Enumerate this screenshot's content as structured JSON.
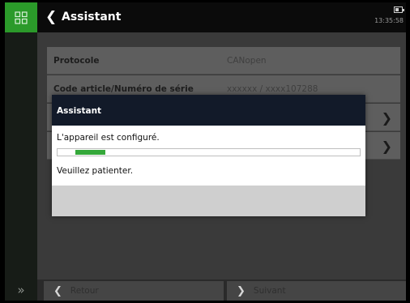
{
  "header": {
    "title": "Assistant",
    "time": "13:35:58"
  },
  "parameters": [
    {
      "label": "Protocole",
      "value": "CANopen"
    },
    {
      "label": "Code article/Numéro de série",
      "value": "xxxxxx / xxxx107288"
    }
  ],
  "footer": {
    "back_label": "Retour",
    "next_label": "Suivant"
  },
  "dialog": {
    "title": "Assistant",
    "message": "L'appareil est configuré.",
    "wait_text": "Veuillez patienter.",
    "progress": {
      "start": 0.06,
      "end": 0.16
    }
  },
  "colors": {
    "accent": "#2b9a2a",
    "progress": "#35a83a",
    "dialog_header": "#121a29"
  },
  "icons": {
    "home": "grid-icon",
    "back": "chevron-left-icon",
    "next": "chevron-right-icon",
    "expand": "double-chevron-right-icon",
    "battery": "battery-icon"
  }
}
